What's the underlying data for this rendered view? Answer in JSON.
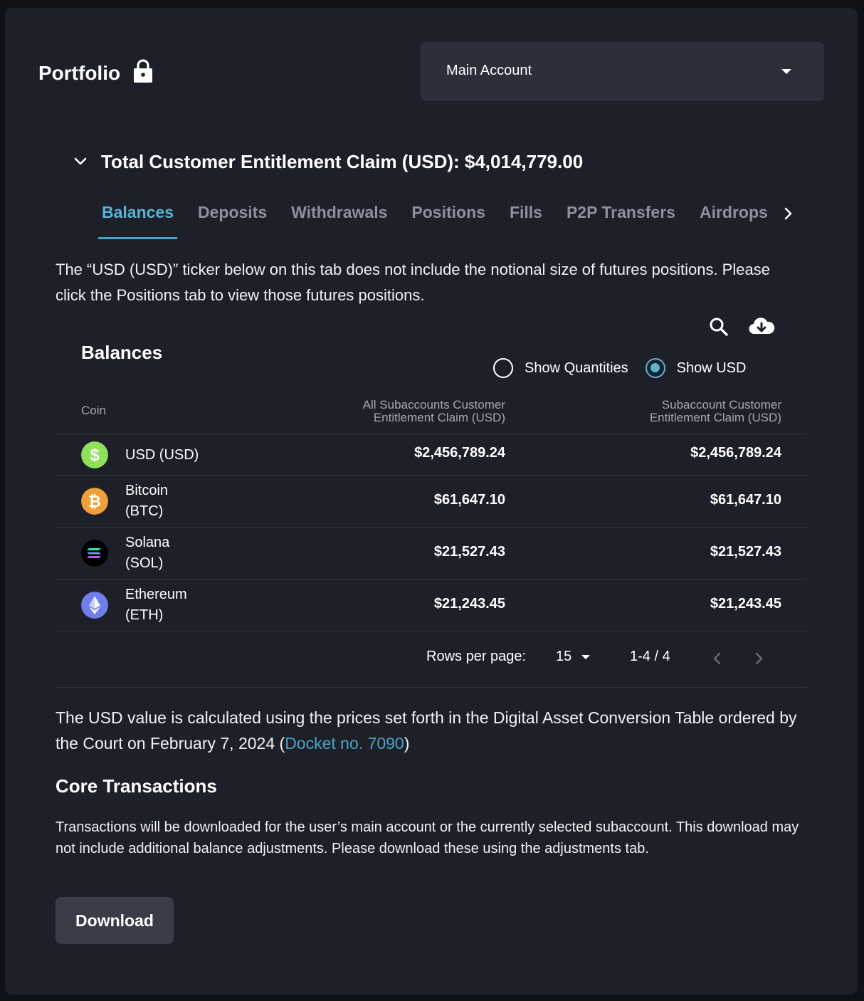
{
  "header": {
    "title": "Portfolio",
    "lock_icon": "lock-icon"
  },
  "account_select": {
    "value": "Main Account"
  },
  "claim": {
    "text": "Total Customer Entitlement Claim (USD): $4,014,779.00"
  },
  "tabs": [
    {
      "label": "Balances",
      "active": true
    },
    {
      "label": "Deposits"
    },
    {
      "label": "Withdrawals"
    },
    {
      "label": "Positions"
    },
    {
      "label": "Fills"
    },
    {
      "label": "P2P Transfers"
    },
    {
      "label": "Airdrops"
    }
  ],
  "notice": "The “USD (USD)” ticker below on this tab does not include the notional size of futures positions. Please click the Positions tab to view those futures positions.",
  "balances": {
    "title": "Balances",
    "toggle": {
      "option_quantities": "Show Quantities",
      "option_usd": "Show USD",
      "selected": "usd"
    },
    "columns": {
      "coin": "Coin",
      "all_line1": "All Subaccounts Customer",
      "all_line2": "Entitlement Claim (USD)",
      "sub_line1": "Subaccount Customer",
      "sub_line2": "Entitlement Claim (USD)"
    },
    "rows": [
      {
        "name_line1": "USD (USD)",
        "name_line2": "",
        "all": "$2,456,789.24",
        "sub": "$2,456,789.24",
        "icon": "usd-coin-icon",
        "color": "#8fe05a"
      },
      {
        "name_line1": "Bitcoin",
        "name_line2": "(BTC)",
        "all": "$61,647.10",
        "sub": "$61,647.10",
        "icon": "bitcoin-icon",
        "color": "#f1a038"
      },
      {
        "name_line1": "Solana",
        "name_line2": "(SOL)",
        "all": "$21,527.43",
        "sub": "$21,527.43",
        "icon": "solana-icon",
        "color": "#000000"
      },
      {
        "name_line1": "Ethereum",
        "name_line2": "(ETH)",
        "all": "$21,243.45",
        "sub": "$21,243.45",
        "icon": "ethereum-icon",
        "color": "#6f7ee8"
      }
    ],
    "pagination": {
      "rows_label": "Rows per page:",
      "rows_value": "15",
      "range": "1-4 / 4"
    }
  },
  "footer_note": {
    "text_before": "The USD value is calculated using the prices set forth in the Digital Asset Conversion Table ordered by the Court on February 7, 2024 (",
    "link": "Docket no. 7090",
    "text_after": ")"
  },
  "core": {
    "title": "Core Transactions",
    "text": "Transactions will be downloaded for the user’s main account or the currently selected subaccount. This download may not include additional balance adjustments. Please download these using the adjustments tab.",
    "button": "Download"
  }
}
